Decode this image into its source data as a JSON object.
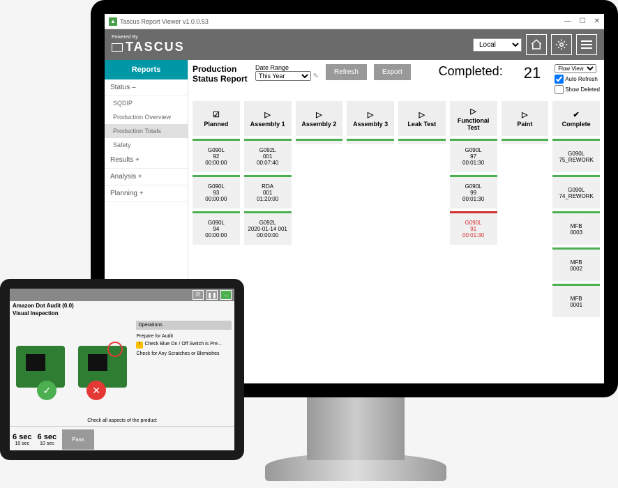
{
  "window": {
    "title": "Tascus Report Viewer   v1.0.0.53"
  },
  "header": {
    "powered": "Powered By",
    "logo": "TASCUS",
    "local": "Local"
  },
  "sidebar": {
    "active_tab": "Reports",
    "groups": {
      "status": {
        "label": "Status  –",
        "items": [
          "SQDIP",
          "Production Overview",
          "Production Totals",
          "Safety"
        ]
      },
      "results": "Results  +",
      "analysis": "Analysis  +",
      "planning": "Planning  +"
    }
  },
  "report": {
    "title": "Production Status Report",
    "date_range_label": "Date Range",
    "date_range_value": "This Year",
    "refresh": "Refresh",
    "export": "Export",
    "completed_label": "Completed:",
    "completed_count": "21",
    "view": {
      "mode": "Flow View",
      "auto_refresh": "Auto Refresh",
      "show_deleted": "Show Deleted"
    }
  },
  "stages": [
    {
      "name": "Planned",
      "icon": "calendar"
    },
    {
      "name": "Assembly 1",
      "icon": "play"
    },
    {
      "name": "Assembly 2",
      "icon": "play"
    },
    {
      "name": "Assembly 3",
      "icon": "play"
    },
    {
      "name": "Leak Test",
      "icon": "play"
    },
    {
      "name": "Functional Test",
      "icon": "play"
    },
    {
      "name": "Paint",
      "icon": "play"
    },
    {
      "name": "Complete",
      "icon": "check"
    }
  ],
  "cards": {
    "planned": [
      {
        "l1": "G090L",
        "l2": "92",
        "l3": "00:00:00"
      },
      {
        "l1": "G090L",
        "l2": "93",
        "l3": "00:00:00"
      },
      {
        "l1": "G090L",
        "l2": "94",
        "l3": "00:00:00"
      }
    ],
    "assembly1": [
      {
        "l1": "G092L",
        "l2": "001",
        "l3": "00:07:40"
      },
      {
        "l1": "RDA",
        "l2": "001",
        "l3": "01:20:00"
      },
      {
        "l1": "G092L",
        "l2": "2020-01-14 001",
        "l3": "00:00:00"
      }
    ],
    "functional": [
      {
        "l1": "G090L",
        "l2": "97",
        "l3": "00:01:30"
      },
      {
        "l1": "G090L",
        "l2": "99",
        "l3": "00:01:30"
      },
      {
        "l1": "G090L",
        "l2": "91",
        "l3": "00:01:30",
        "red": true
      }
    ],
    "complete": [
      {
        "l1": "G090L",
        "l2": "75_REWORK"
      },
      {
        "l1": "G090L",
        "l2": "74_REWORK"
      },
      {
        "l1": "MFB",
        "l2": "0003"
      },
      {
        "l1": "MFB",
        "l2": "0002"
      },
      {
        "l1": "MFB",
        "l2": "0001"
      }
    ]
  },
  "tablet": {
    "title": "Amazon Dot Audit (0.0)",
    "subtitle": "Visual Inspection",
    "ops_header": "Operations",
    "ops": [
      "Prepare for Audit",
      "Check Blue On / Off Switch is Pre...",
      "Check for Any Scratches or Blemishes"
    ],
    "footer_text": "Check all aspects of the product",
    "timer1": {
      "val": "6 sec",
      "sub": "10 sec"
    },
    "timer2": {
      "val": "6 sec",
      "sub": "10 sec"
    },
    "pass": "Pass"
  }
}
